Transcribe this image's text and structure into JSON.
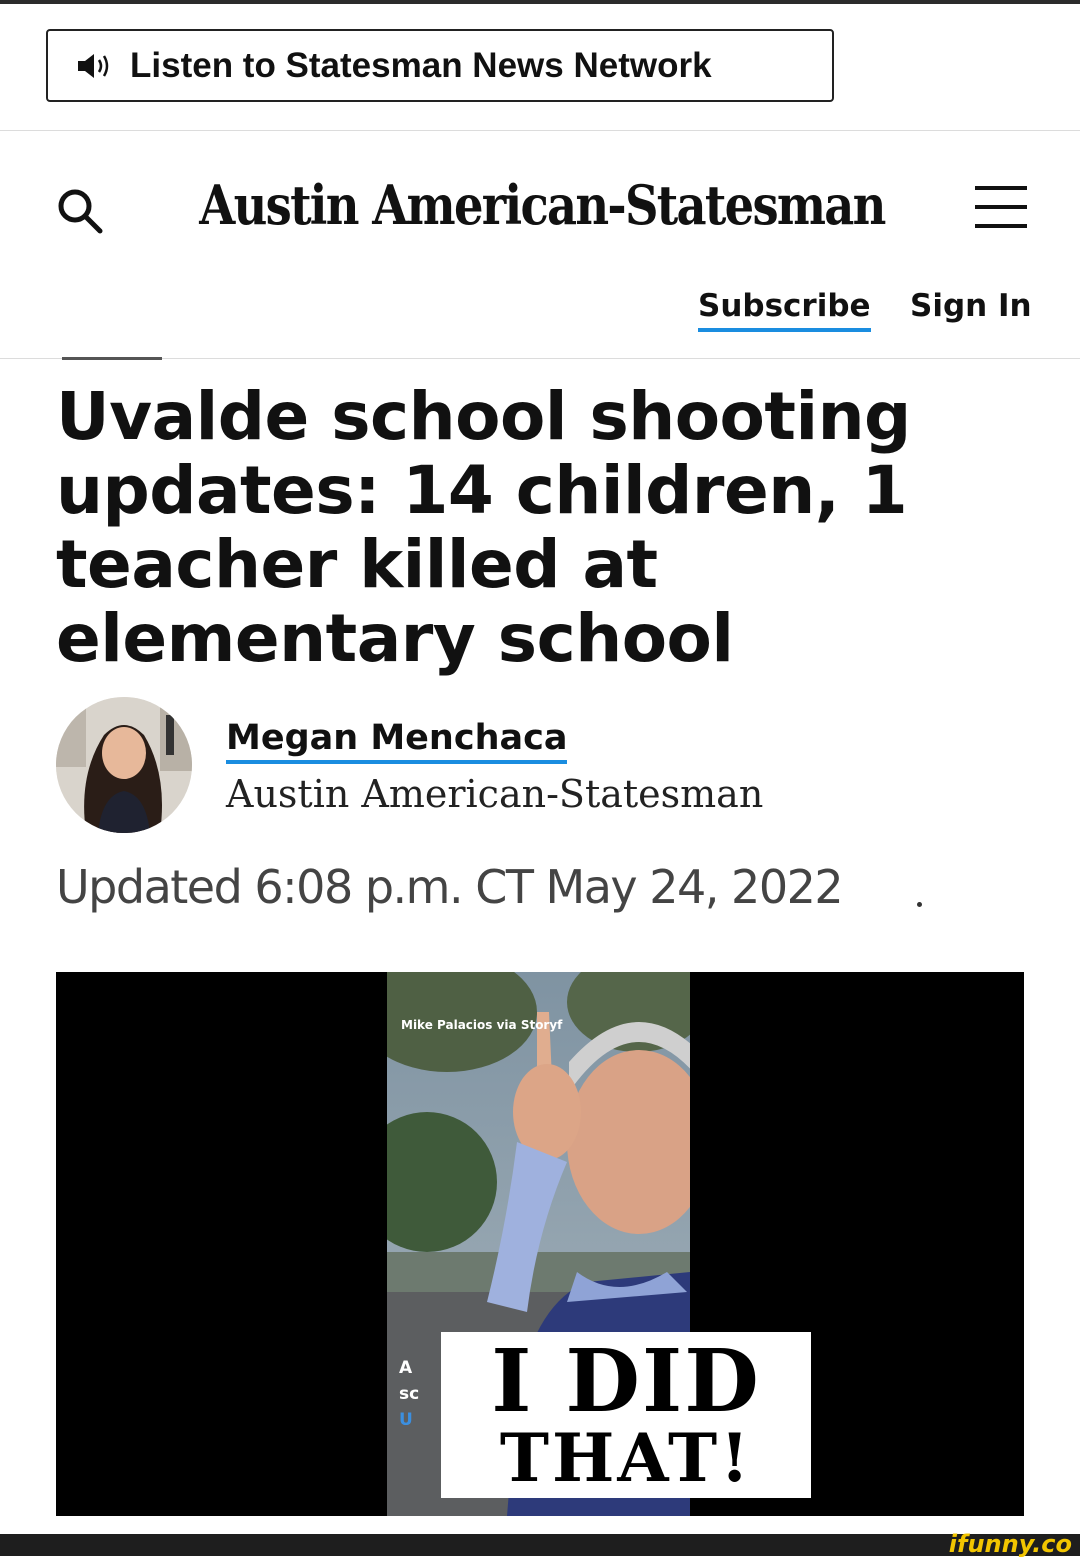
{
  "listen": {
    "label": "Listen to Statesman News Network"
  },
  "masthead": {
    "title": "Austin American-Statesman"
  },
  "account": {
    "subscribe_label": "Subscribe",
    "signin_label": "Sign In"
  },
  "article": {
    "headline": "Uvalde school shooting updates: 14 children, 1 teacher killed at elementary school",
    "author_name": "Megan Menchaca",
    "author_org": "Austin American-Statesman",
    "updated": "Updated 6:08 p.m. CT May 24, 2022"
  },
  "media": {
    "credit": "Mike Palacios via Storyf",
    "overlay_line1": "I DID",
    "overlay_line2": "THAT!",
    "ghost_text": [
      "A",
      "sc",
      "U"
    ]
  },
  "watermark": {
    "text": "ifunny.co"
  },
  "icons": {
    "listen": "speaker-icon",
    "search": "search-icon",
    "menu": "hamburger-menu-icon"
  },
  "colors": {
    "link_underline": "#1a8de0",
    "watermark": "#f2c500"
  }
}
